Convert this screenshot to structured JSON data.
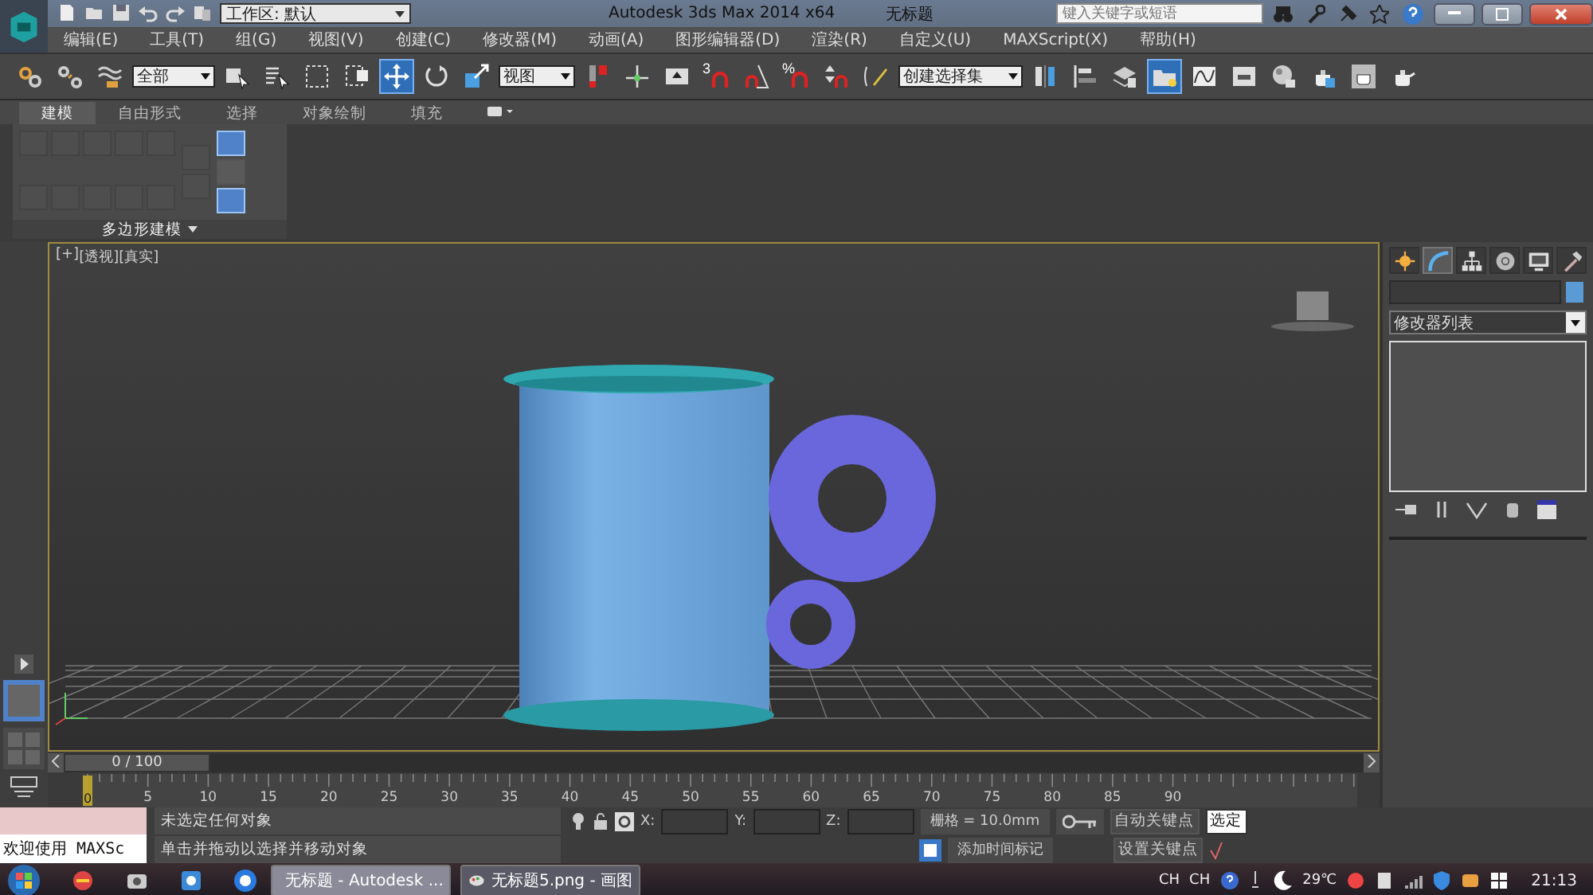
{
  "title_bar": {
    "workspace": "工作区: 默认",
    "app": "Autodesk 3ds Max  2014 x64",
    "document": "无标题",
    "search": {
      "placeholder": "键入关键字或短语"
    }
  },
  "menu": [
    "编辑(E)",
    "工具(T)",
    "组(G)",
    "视图(V)",
    "创建(C)",
    "修改器(M)",
    "动画(A)",
    "图形编辑器(D)",
    "渲染(R)",
    "自定义(U)",
    "MAXScript(X)",
    "帮助(H)"
  ],
  "toolbar": [
    {
      "kind": "link",
      "selected": false
    },
    {
      "kind": "unlink",
      "selected": false
    },
    {
      "kind": "bind",
      "selected": false
    },
    {
      "kind": "dropdown",
      "value": "全部"
    },
    {
      "kind": "select",
      "selected": false
    },
    {
      "kind": "select-by-name",
      "selected": false
    },
    {
      "kind": "rect-region",
      "selected": false
    },
    {
      "kind": "window-crossing",
      "selected": false
    },
    {
      "kind": "move",
      "selected": true
    },
    {
      "kind": "rotate",
      "selected": false
    },
    {
      "kind": "scale",
      "selected": false
    },
    {
      "kind": "dropdown",
      "value": "视图"
    },
    {
      "kind": "pivot",
      "selected": false
    },
    {
      "kind": "manipulate",
      "selected": false
    },
    {
      "kind": "keyboard",
      "selected": false
    },
    {
      "kind": "snap",
      "label": "3",
      "selected": false
    },
    {
      "kind": "angle-snap",
      "selected": false
    },
    {
      "kind": "percent-snap",
      "label": "%",
      "selected": false
    },
    {
      "kind": "spinner-snap",
      "selected": false
    },
    {
      "kind": "named-selection",
      "selected": false
    },
    {
      "kind": "dropdown",
      "value": "创建选择集"
    },
    {
      "kind": "mirror",
      "selected": false
    },
    {
      "kind": "align",
      "selected": false
    },
    {
      "kind": "layers",
      "selected": false
    },
    {
      "kind": "scene-explorer",
      "selected": true
    },
    {
      "kind": "curve-editor",
      "selected": false
    },
    {
      "kind": "schematic",
      "selected": false
    },
    {
      "kind": "material",
      "selected": false
    },
    {
      "kind": "render-setup",
      "selected": false
    },
    {
      "kind": "render-frame",
      "selected": false
    },
    {
      "kind": "render",
      "selected": false
    }
  ],
  "ribbon": {
    "tabs": [
      {
        "label": "建模",
        "selected": true
      },
      {
        "label": "自由形式",
        "selected": false
      },
      {
        "label": "选择",
        "selected": false
      },
      {
        "label": "对象绘制",
        "selected": false
      },
      {
        "label": "填充",
        "selected": false
      }
    ],
    "panel": {
      "title": "多边形建模",
      "tools": [
        {
          "disabled": true
        },
        {
          "disabled": true
        },
        {
          "disabled": true
        },
        {
          "disabled": true
        },
        {
          "disabled": true
        },
        {
          "disabled": true
        },
        {
          "disabled": true
        },
        {
          "disabled": true
        },
        {
          "disabled": true
        },
        {
          "disabled": true
        },
        {
          "disabled": true
        },
        {
          "disabled": true
        }
      ],
      "toggles": [
        {
          "selected": true
        },
        {
          "selected": false
        },
        {
          "selected": true
        }
      ]
    }
  },
  "viewport": {
    "labels": [
      "[+]",
      "[透视]",
      "[真实]"
    ],
    "active": true
  },
  "command_panel": {
    "tabs": [
      {
        "kind": "create",
        "selected": false
      },
      {
        "kind": "modify",
        "selected": true
      },
      {
        "kind": "hierarchy",
        "selected": false
      },
      {
        "kind": "motion",
        "selected": false
      },
      {
        "kind": "display",
        "selected": false
      },
      {
        "kind": "utilities",
        "selected": false
      }
    ],
    "modifier_list": "修改器列表"
  },
  "timeline": {
    "position": "0 / 100",
    "frame": "0",
    "level": 0,
    "ticks": [
      "5",
      "10",
      "15",
      "20",
      "25",
      "30",
      "35",
      "40",
      "45",
      "50",
      "55",
      "60",
      "65",
      "70",
      "75",
      "80",
      "85",
      "90"
    ]
  },
  "status": {
    "listener": "欢迎使用 MAXSc",
    "prompt": "未选定任何对象",
    "hint": "单击并拖动以选择并移动对象",
    "coords": [
      "X:",
      "Y:",
      "Z:"
    ],
    "grid": "栅格 = 10.0mm",
    "time_tag": "添加时间标记",
    "auto_key": "自动关键点",
    "set_key": "设置关键点",
    "key_filter": "选定"
  },
  "taskbar": {
    "tasks": [
      {
        "label": "无标题 - Autodesk ...",
        "selected": true,
        "kind": "max"
      },
      {
        "label": "无标题5.png - 画图",
        "selected": false,
        "kind": "paint"
      }
    ],
    "languages": [
      "CH",
      "CH"
    ],
    "temperature": "29℃",
    "time": "21:13"
  }
}
